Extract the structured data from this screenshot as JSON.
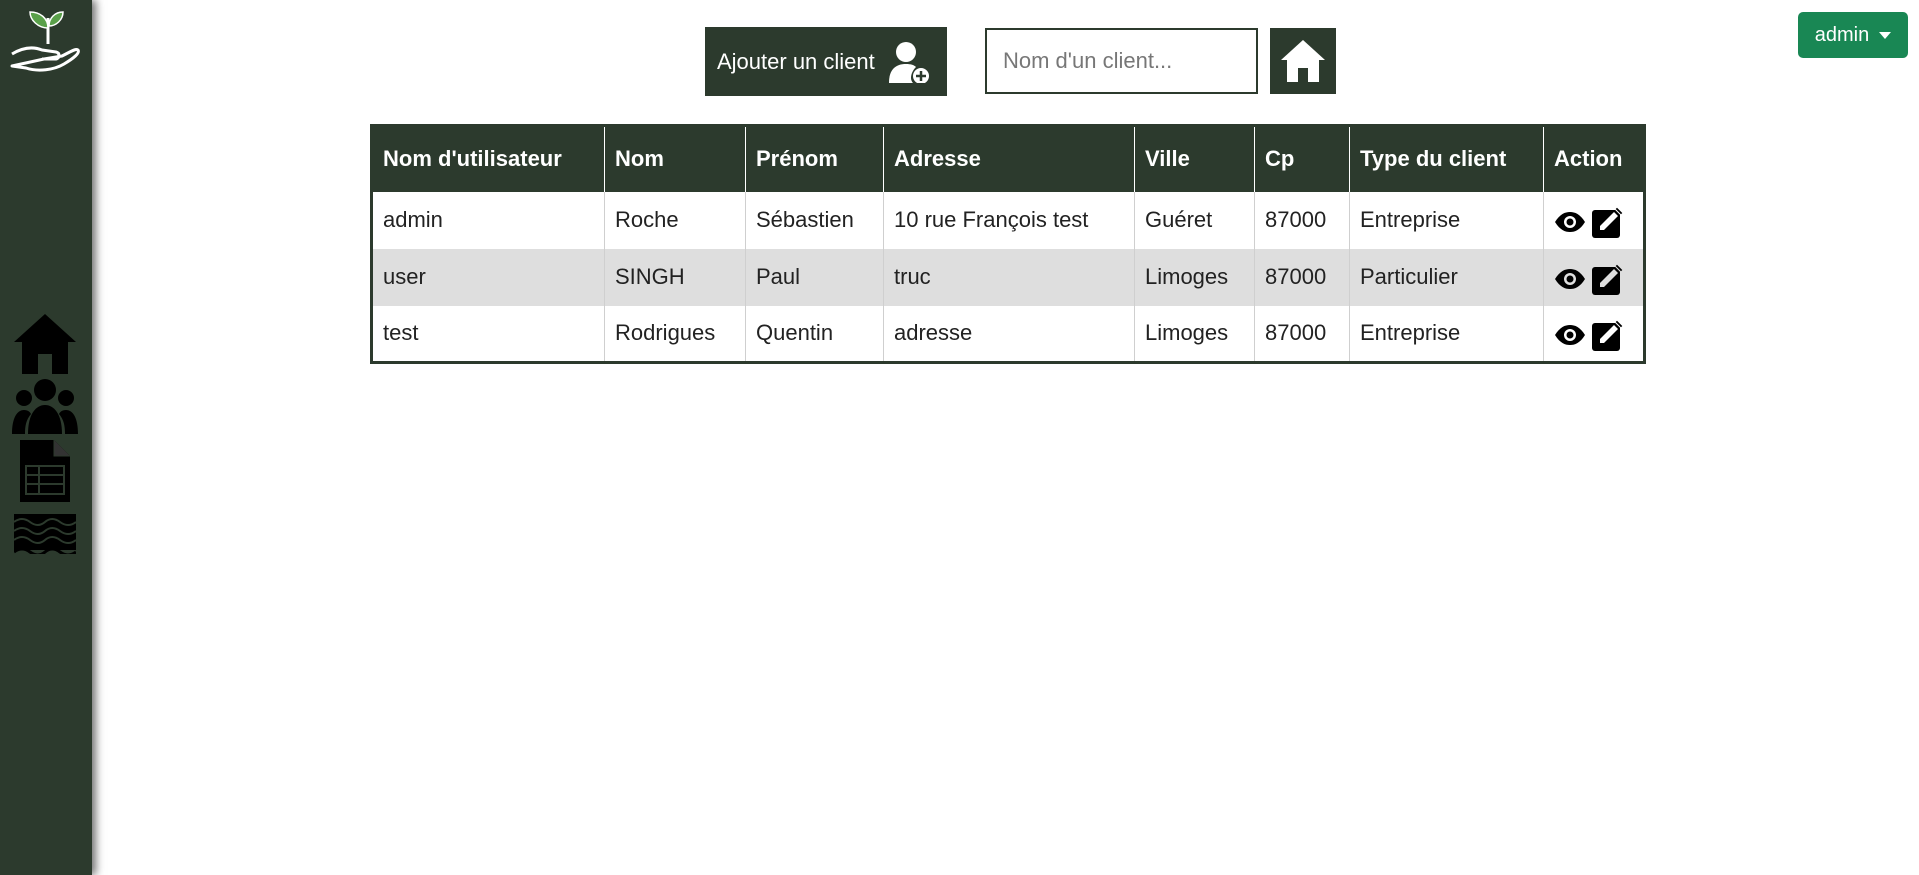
{
  "sidebar": {
    "logo_icon": "hand-plant-icon",
    "items": [
      {
        "icon": "home-icon"
      },
      {
        "icon": "users-icon"
      },
      {
        "icon": "spreadsheet-document-icon"
      },
      {
        "icon": "field-texture-icon"
      }
    ]
  },
  "toolbar": {
    "add_client_label": "Ajouter un client",
    "add_client_icon": "user-plus-icon",
    "search_placeholder": "Nom d'un client...",
    "search_value": "",
    "home_icon": "home-icon"
  },
  "user_menu": {
    "label": "admin"
  },
  "table": {
    "headers": [
      "Nom d'utilisateur",
      "Nom",
      "Prénom",
      "Adresse",
      "Ville",
      "Cp",
      "Type du client",
      "Action"
    ],
    "rows": [
      {
        "username": "admin",
        "nom": "Roche",
        "prenom": "Sébastien",
        "adresse": "10 rue François test",
        "ville": "Guéret",
        "cp": "87000",
        "type": "Entreprise"
      },
      {
        "username": "user",
        "nom": "SINGH",
        "prenom": "Paul",
        "adresse": "truc",
        "ville": "Limoges",
        "cp": "87000",
        "type": "Particulier"
      },
      {
        "username": "test",
        "nom": "Rodrigues",
        "prenom": "Quentin",
        "adresse": "adresse",
        "ville": "Limoges",
        "cp": "87000",
        "type": "Entreprise"
      }
    ],
    "action_icons": [
      "eye-icon",
      "edit-icon"
    ]
  },
  "colors": {
    "primary_dark_green": "#2c3a2d",
    "user_button_green": "#198754",
    "row_alt_gray": "#dedede"
  }
}
